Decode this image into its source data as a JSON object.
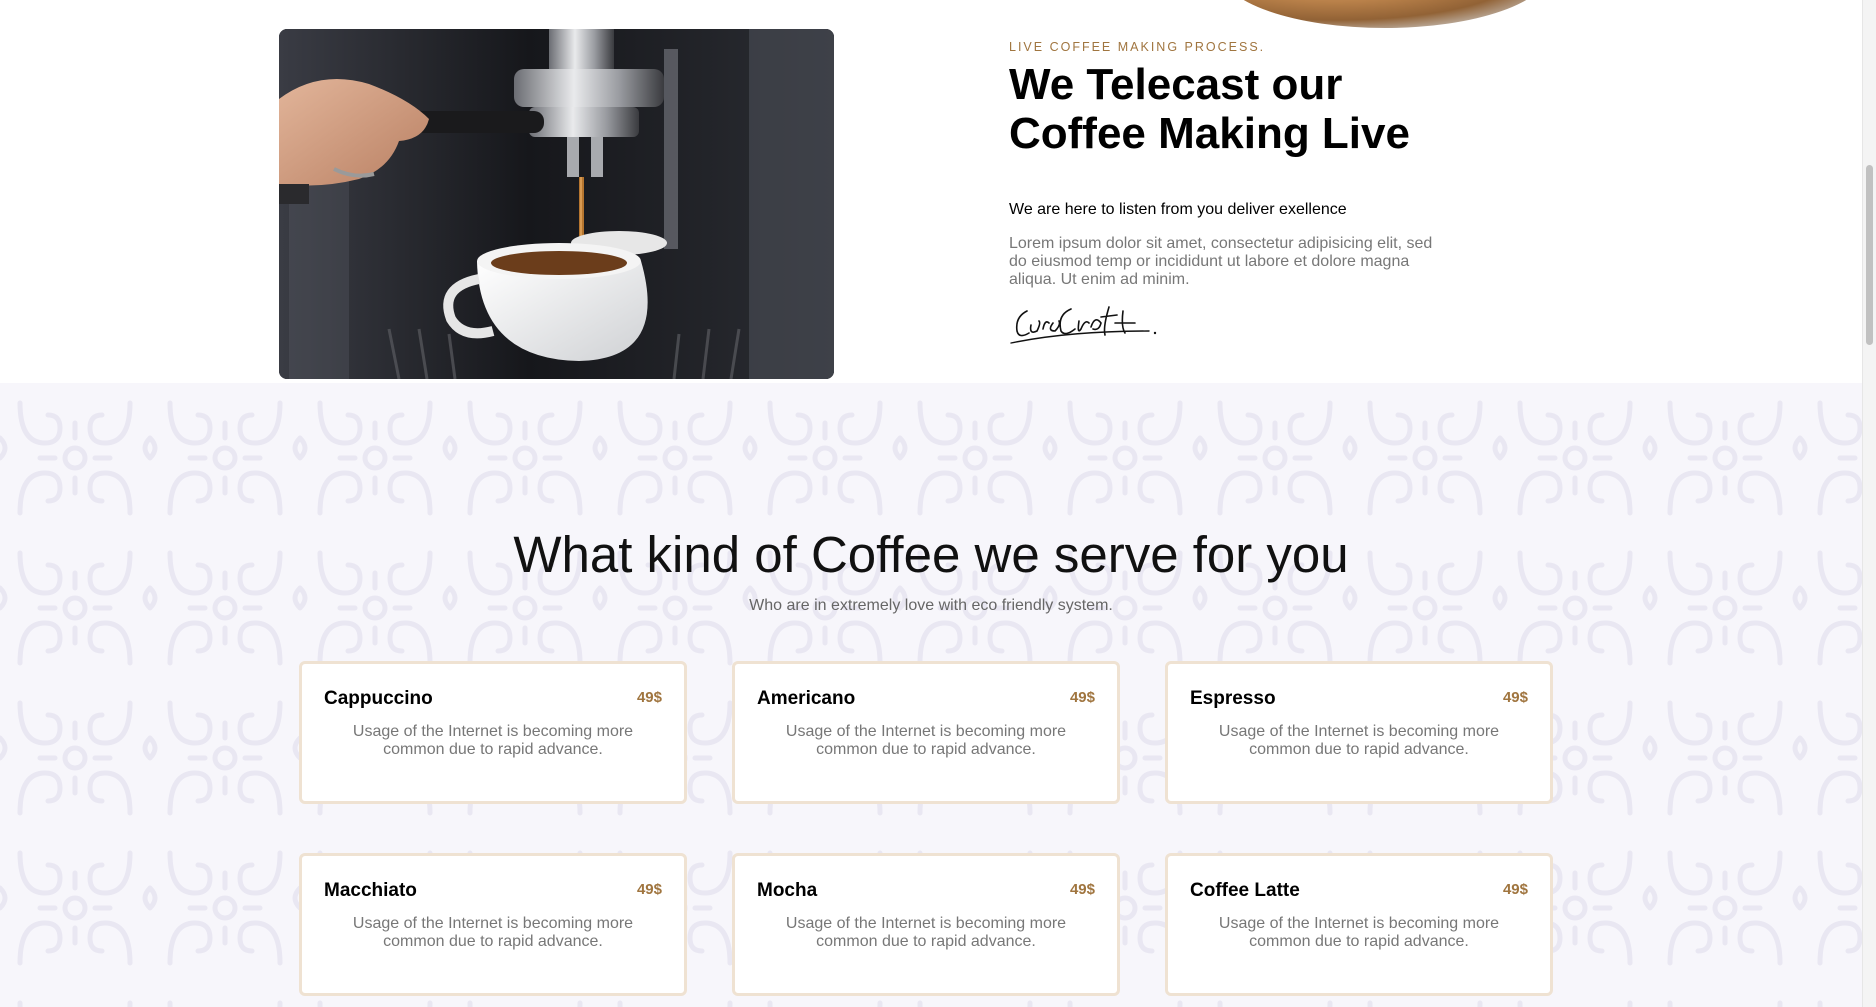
{
  "live": {
    "eyebrow": "LIVE COFFEE MAKING PROCESS.",
    "title": "We Telecast our Coffee Making Live",
    "subtitle": "We are here to listen from you deliver exellence",
    "body": "Lorem ipsum dolor sit amet, consectetur adipisicing elit, sed do eiusmod temp or incididunt ut labore et dolore magna aliqua. Ut enim ad minim.",
    "signature_text": "CaraCroft",
    "image": "espresso-machine-pouring-coffee-photo"
  },
  "menu": {
    "title": "What kind of Coffee we serve for you",
    "subtitle": "Who are in extremely love with eco friendly system.",
    "items": [
      {
        "name": "Cappuccino",
        "price": "49$",
        "desc": "Usage of the Internet is becoming more common due to rapid advance."
      },
      {
        "name": "Americano",
        "price": "49$",
        "desc": "Usage of the Internet is becoming more common due to rapid advance."
      },
      {
        "name": "Espresso",
        "price": "49$",
        "desc": "Usage of the Internet is becoming more common due to rapid advance."
      },
      {
        "name": "Macchiato",
        "price": "49$",
        "desc": "Usage of the Internet is becoming more common due to rapid advance."
      },
      {
        "name": "Mocha",
        "price": "49$",
        "desc": "Usage of the Internet is becoming more common due to rapid advance."
      },
      {
        "name": "Coffee Latte",
        "price": "49$",
        "desc": "Usage of the Internet is becoming more common due to rapid advance."
      }
    ]
  },
  "colors": {
    "accent": "#a0753f",
    "section_bg": "#f7f6fb",
    "card_border": "#efe2d2"
  },
  "scroll": {
    "position_fraction": 0.18
  }
}
